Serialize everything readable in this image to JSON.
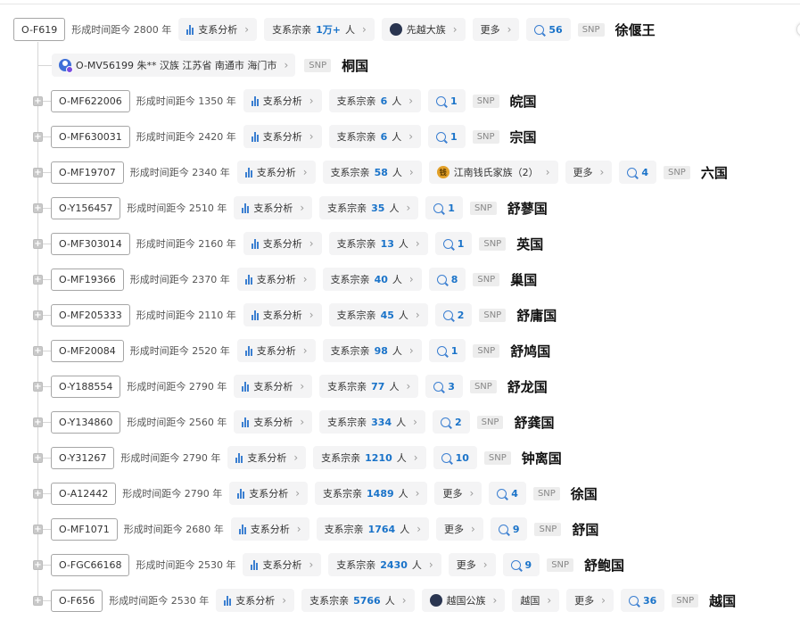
{
  "labels": {
    "time_prefix": "形成时间距今",
    "time_suffix": "年",
    "analysis": "支系分析",
    "clan_prefix": "支系宗亲",
    "person_suffix": "人",
    "more": "更多",
    "snp": "SNP",
    "plus": "+"
  },
  "root": {
    "code": "O-F619",
    "time": "2800",
    "clan": "1万+",
    "tag": "先越大族",
    "questions": "56",
    "name": "徐偃王"
  },
  "sample": {
    "text": "O-MV56199 朱** 汉族 江苏省 南通市 海门市",
    "name": "桐国"
  },
  "rows": [
    {
      "code": "O-MF622006",
      "time": "1350",
      "clan": "6",
      "q": "1",
      "name": "皖国"
    },
    {
      "code": "O-MF630031",
      "time": "2420",
      "clan": "6",
      "q": "1",
      "name": "宗国"
    },
    {
      "code": "O-MF19707",
      "time": "2340",
      "clan": "58",
      "tag": "江南钱氏家族（2）",
      "more": true,
      "q": "4",
      "name": "六国"
    },
    {
      "code": "O-Y156457",
      "time": "2510",
      "clan": "35",
      "q": "1",
      "name": "舒蓼国"
    },
    {
      "code": "O-MF303014",
      "time": "2160",
      "clan": "13",
      "q": "1",
      "name": "英国"
    },
    {
      "code": "O-MF19366",
      "time": "2370",
      "clan": "40",
      "q": "8",
      "name": "巢国"
    },
    {
      "code": "O-MF205333",
      "time": "2110",
      "clan": "45",
      "q": "2",
      "name": "舒庸国"
    },
    {
      "code": "O-MF20084",
      "time": "2520",
      "clan": "98",
      "q": "1",
      "name": "舒鸠国"
    },
    {
      "code": "O-Y188554",
      "time": "2790",
      "clan": "77",
      "q": "3",
      "name": "舒龙国"
    },
    {
      "code": "O-Y134860",
      "time": "2560",
      "clan": "334",
      "q": "2",
      "name": "舒龚国"
    },
    {
      "code": "O-Y31267",
      "time": "2790",
      "clan": "1210",
      "q": "10",
      "name": "钟离国"
    },
    {
      "code": "O-A12442",
      "time": "2790",
      "clan": "1489",
      "more": true,
      "q": "4",
      "name": "徐国"
    },
    {
      "code": "O-MF1071",
      "time": "2680",
      "clan": "1764",
      "more": true,
      "q": "9",
      "name": "舒国"
    },
    {
      "code": "O-FGC66168",
      "time": "2530",
      "clan": "2430",
      "more": true,
      "q": "9",
      "name": "舒鲍国"
    },
    {
      "code": "O-F656",
      "time": "2530",
      "clan": "5766",
      "tag": "越国公族",
      "tag2": "越国",
      "more": true,
      "q": "36",
      "name": "越国"
    }
  ],
  "colors": {
    "accent": "#1a73c9",
    "line": "#d6d6d6",
    "chip": "#f4f4f5"
  },
  "icons": [
    "bar-chart-icon",
    "chat-bubble-icon",
    "chevron-right-icon",
    "plus-box-icon",
    "clan-avatar-icon",
    "user-avatar-icon"
  ]
}
